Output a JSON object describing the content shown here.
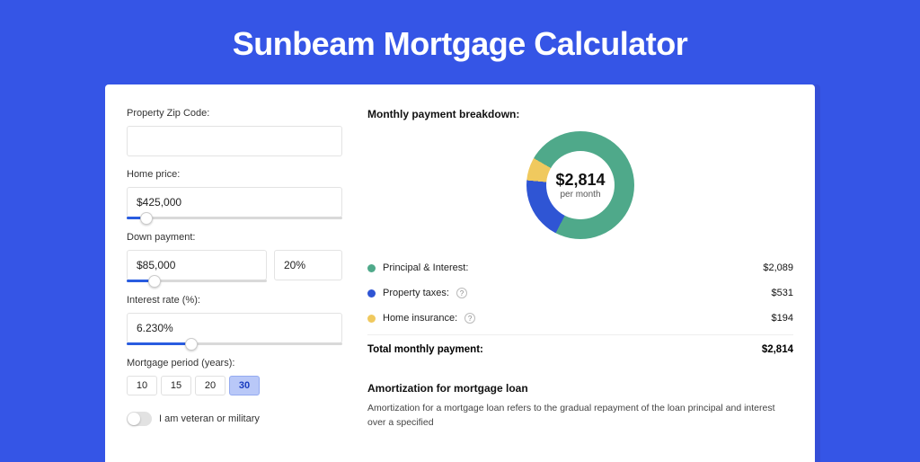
{
  "page_title": "Sunbeam Mortgage Calculator",
  "form": {
    "zip_label": "Property Zip Code:",
    "zip_value": "",
    "home_price_label": "Home price:",
    "home_price_value": "$425,000",
    "home_price_slider_pct": 9,
    "down_payment_label": "Down payment:",
    "down_payment_value": "$85,000",
    "down_payment_pct_value": "20%",
    "down_payment_slider_pct": 20,
    "interest_label": "Interest rate (%):",
    "interest_value": "6.230%",
    "interest_slider_pct": 30,
    "period_label": "Mortgage period (years):",
    "period_options": [
      "10",
      "15",
      "20",
      "30"
    ],
    "period_selected": "30",
    "veteran_label": "I am veteran or military",
    "veteran_on": false
  },
  "breakdown": {
    "title": "Monthly payment breakdown:",
    "center_amount": "$2,814",
    "center_sub": "per month",
    "items": [
      {
        "label": "Principal & Interest:",
        "value": "$2,089",
        "num": 2089,
        "color": "#4fa98a",
        "help": false
      },
      {
        "label": "Property taxes:",
        "value": "$531",
        "num": 531,
        "color": "#2f55d4",
        "help": true
      },
      {
        "label": "Home insurance:",
        "value": "$194",
        "num": 194,
        "color": "#f0c95e",
        "help": true
      }
    ],
    "total_label": "Total monthly payment:",
    "total_value": "$2,814",
    "total_num": 2814
  },
  "amortization": {
    "title": "Amortization for mortgage loan",
    "text": "Amortization for a mortgage loan refers to the gradual repayment of the loan principal and interest over a specified"
  },
  "chart_data": {
    "type": "pie",
    "title": "Monthly payment breakdown",
    "categories": [
      "Principal & Interest",
      "Property taxes",
      "Home insurance"
    ],
    "values": [
      2089,
      531,
      194
    ],
    "colors": [
      "#4fa98a",
      "#2f55d4",
      "#f0c95e"
    ],
    "total": 2814,
    "center_label": "$2,814 per month"
  }
}
